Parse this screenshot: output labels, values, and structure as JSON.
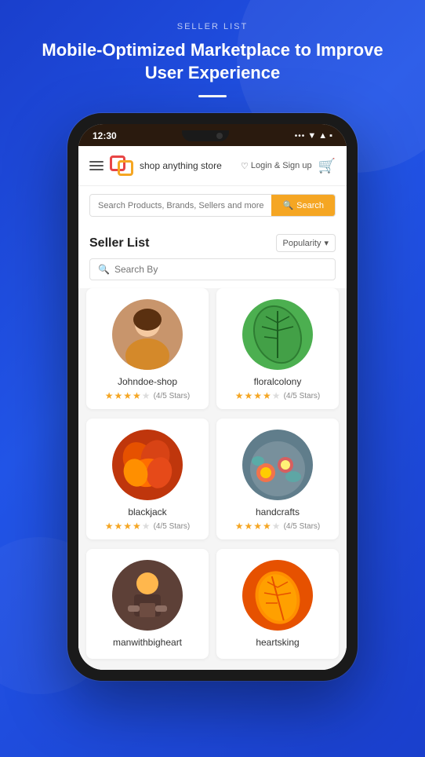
{
  "page": {
    "header": {
      "label": "SELLER LIST",
      "title": "Mobile-Optimized Marketplace to Improve User Experience"
    }
  },
  "status_bar": {
    "time": "12:30",
    "right": "... ▼ ▲ ■"
  },
  "nav": {
    "store_name": "shop anything store",
    "login_text": "Login & Sign up",
    "search_placeholder": "Search Products, Brands, Sellers and more...",
    "search_btn": "Search"
  },
  "seller_section": {
    "title": "Seller List",
    "sort_label": "Popularity",
    "search_by_placeholder": "Search By",
    "sellers": [
      {
        "name": "Johndoe-shop",
        "rating": "4/5 Stars",
        "stars": 4,
        "color1": "#c8956c",
        "color2": "#8b5e3c"
      },
      {
        "name": "floralcolony",
        "rating": "4/5 Stars",
        "stars": 4,
        "color1": "#4caf50",
        "color2": "#1b5e20"
      },
      {
        "name": "blackjack",
        "rating": "4/5 Stars",
        "stars": 4,
        "color1": "#e65100",
        "color2": "#bf360c"
      },
      {
        "name": "handcrafts",
        "rating": "4/5 Stars",
        "stars": 4,
        "color1": "#607d8b",
        "color2": "#37474f"
      },
      {
        "name": "manwithbigheart",
        "rating": "",
        "stars": 0,
        "color1": "#5d4037",
        "color2": "#3e2723"
      },
      {
        "name": "heartsking",
        "rating": "",
        "stars": 0,
        "color1": "#ff8f00",
        "color2": "#e65100"
      }
    ]
  }
}
